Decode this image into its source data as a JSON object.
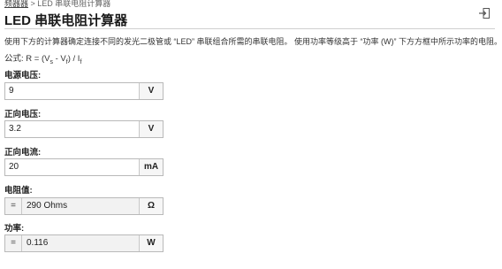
{
  "breadcrumb": {
    "link": "频器器",
    "separator": " > ",
    "current": "LED 串联电阻计算器"
  },
  "title": "LED 串联电阻计算器",
  "description": "使用下方的计算器确定连接不同的发光二极管或 “LED” 串联组合所需的串联电阻。 使用功率等级高于 “功率 (W)” 下方方框中所示功率的电阻。",
  "formula": {
    "prefix": "公式: R = (V",
    "sub_s": "s",
    "mid": " - V",
    "sub_f": "f",
    "close": ") / I",
    "sub_f2": "f"
  },
  "fields": {
    "supply_voltage": {
      "label": "电源电压:",
      "value": "9",
      "unit": "V"
    },
    "forward_voltage": {
      "label": "正向电压:",
      "value": "3.2",
      "unit": "V"
    },
    "forward_current": {
      "label": "正向电流:",
      "value": "20",
      "unit": "mA"
    },
    "resistance": {
      "label": "电阻值:",
      "eq": "=",
      "value": "290 Ohms",
      "unit": "Ω"
    },
    "power": {
      "label": "功率:",
      "eq": "=",
      "value": "0.116",
      "unit": "W"
    }
  }
}
